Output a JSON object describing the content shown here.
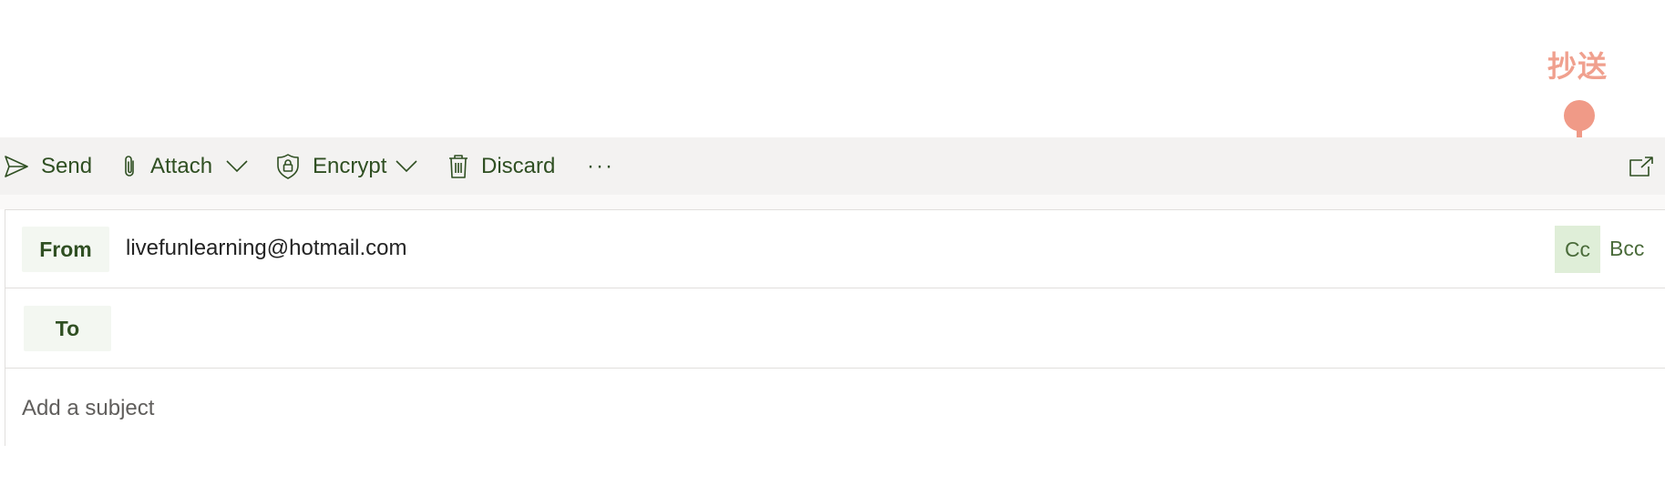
{
  "annotation": {
    "label": "抄送",
    "color": "#f09a87"
  },
  "toolbar": {
    "send_label": "Send",
    "attach_label": "Attach",
    "encrypt_label": "Encrypt",
    "discard_label": "Discard",
    "more_label": "···"
  },
  "compose": {
    "from_label": "From",
    "from_value": "livefunlearning@hotmail.com",
    "cc_label": "Cc",
    "bcc_label": "Bcc",
    "to_label": "To",
    "to_value": "",
    "subject_placeholder": "Add a subject"
  },
  "colors": {
    "accent_text": "#2f4f22",
    "toolbar_bg": "#f3f2f1",
    "chip_bg": "#f3f7f1",
    "cc_bg": "#dfeed8"
  }
}
